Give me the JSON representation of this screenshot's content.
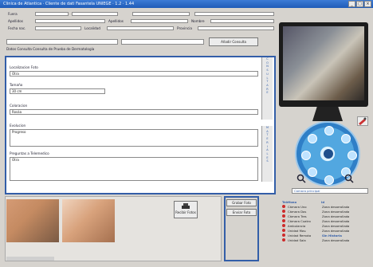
{
  "window": {
    "title": "Clinica de Atlantica · Cliente de dati Fasantela UNIEGE · 1.2 · 1.44",
    "controls": [
      "_",
      "□",
      "×"
    ]
  },
  "header": {
    "row1": {
      "l1": "Fuera",
      "l2": "",
      "l3": "",
      "l4": ""
    },
    "row2": {
      "l1": "Apellidos",
      "l2": "Apellidos",
      "l3": "Nombre"
    },
    "row3": {
      "l1": "Fecha nac.",
      "l2": "Localidad",
      "l3": "Provincia"
    }
  },
  "toolbar": {
    "action_button": "Añadir Consulta",
    "tab_label": "Datos Consulta  Consulta de Prueba de Dermatología"
  },
  "consult_form": {
    "fields": [
      {
        "label": "Localizacion Foto",
        "value": "Otra"
      },
      {
        "label": "Tamaño",
        "value": "30 cm"
      },
      {
        "label": "Coloracion",
        "value": "Rosáa"
      },
      {
        "label": "Evolucion",
        "value": "Progreso"
      },
      {
        "label": "Preguntas a Telemedico",
        "value": "Otra"
      }
    ],
    "side_letters_top": [
      "C",
      "O",
      "N",
      "S",
      "U",
      "L",
      "T",
      "A",
      "R",
      "E"
    ],
    "side_letters_bottom": [
      "M",
      "A",
      "T",
      "E",
      "R",
      "I",
      "A",
      "L",
      "E",
      "S"
    ]
  },
  "photos": {
    "upload_button": "Recibir Fotos",
    "capture_button": "Grabar Foto",
    "send_button": "Enviar Foto"
  },
  "video": {
    "camera_select": "Camara principal"
  },
  "legend": {
    "head_left": "Teléfono",
    "head_right": "Id",
    "rows": [
      {
        "left": "Cámara Uno",
        "right": "Zona desarrollada"
      },
      {
        "left": "Cámara Dos",
        "right": "Zona desarrollada"
      },
      {
        "left": "Cámara Tres",
        "right": "Zona desarrollada"
      },
      {
        "left": "Cámara Cuatro",
        "right": "Zona desarrollada"
      },
      {
        "left": "Ambulancia",
        "right": "Zona desarrollada"
      },
      {
        "left": "Unidad Mov.",
        "right": "Zona desarrollada"
      },
      {
        "left": "Unidad Remota",
        "right": "Sin Historia"
      },
      {
        "left": "Unidad Sala",
        "right": "Zona desarrollada"
      }
    ]
  }
}
